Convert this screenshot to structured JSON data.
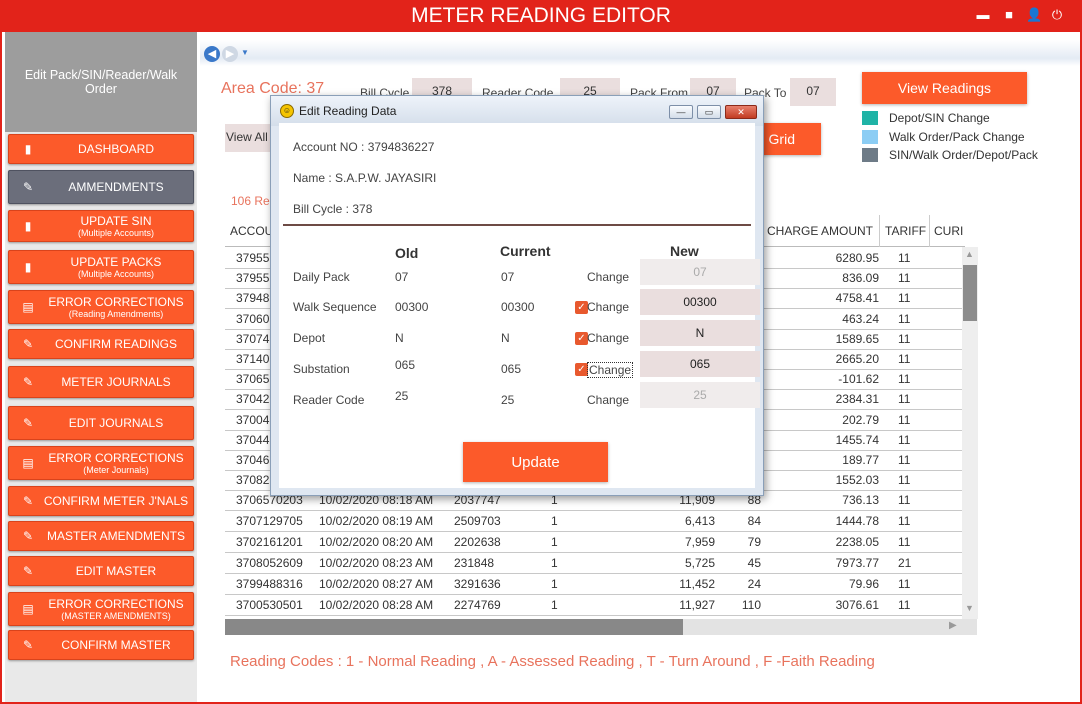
{
  "app": {
    "title": "METER READING EDITOR"
  },
  "window_controls": {
    "minimize": "▬",
    "maximize": "■",
    "user": "👤",
    "power": "⏻"
  },
  "sidebar": {
    "header": "Edit Pack/SIN/Reader/Walk Order",
    "items": [
      {
        "label": "DASHBOARD",
        "sub": "",
        "icon": "document-icon",
        "glyph": "▮"
      },
      {
        "label": "AMMENDMENTS",
        "sub": "",
        "icon": "user-edit-icon",
        "glyph": "✎"
      },
      {
        "label": "UPDATE SIN",
        "sub": "(Multiple Accounts)",
        "icon": "document-icon",
        "glyph": "▮"
      },
      {
        "label": "UPDATE PACKS",
        "sub": "(Multiple Accounts)",
        "icon": "document-icon",
        "glyph": "▮"
      },
      {
        "label": "ERROR CORRECTIONS",
        "sub": "(Reading Amendments)",
        "icon": "list-icon",
        "glyph": "▤"
      },
      {
        "label": "CONFIRM READINGS",
        "sub": "",
        "icon": "pencil-icon",
        "glyph": "✎"
      },
      {
        "label": "METER JOURNALS",
        "sub": "",
        "icon": "user-edit-icon",
        "glyph": "✎"
      },
      {
        "label": "EDIT JOURNALS",
        "sub": "",
        "icon": "user-edit-icon",
        "glyph": "✎"
      },
      {
        "label": "ERROR CORRECTIONS",
        "sub": "(Meter Journals)",
        "icon": "list-icon",
        "glyph": "▤"
      },
      {
        "label": "CONFIRM METER J'NALS",
        "sub": "",
        "icon": "pencil-icon",
        "glyph": "✎"
      },
      {
        "label": "MASTER AMENDMENTS",
        "sub": "",
        "icon": "pencil-icon",
        "glyph": "✎"
      },
      {
        "label": "EDIT MASTER",
        "sub": "",
        "icon": "pencil-icon",
        "glyph": "✎"
      },
      {
        "label": "ERROR CORRECTIONS",
        "sub": "(MASTER AMENDMENTS)",
        "icon": "list-icon",
        "glyph": "▤"
      },
      {
        "label": "CONFIRM MASTER",
        "sub": "",
        "icon": "pencil-icon",
        "glyph": "✎"
      }
    ]
  },
  "filters": {
    "area_code": "Area Code: 37",
    "bill_cycle_label": "Bill Cycle",
    "bill_cycle": "378",
    "reader_code_label": "Reader Code",
    "reader_code": "25",
    "pack_from_label": "Pack From",
    "pack_from": "07",
    "pack_to_label": "Pack To",
    "pack_to": "07"
  },
  "buttons": {
    "view_readings": "View Readings",
    "view_all": "View All",
    "grid": "Grid",
    "update": "Update"
  },
  "legend": [
    {
      "label": "Depot/SIN Change",
      "color": "#1fb3a6"
    },
    {
      "label": "Walk Order/Pack Change",
      "color": "#8ccdf4"
    },
    {
      "label": "SIN/Walk Order/Depot/Pack",
      "color": "#6e7b87"
    }
  ],
  "record_count": "106 Re",
  "grid": {
    "headers": {
      "account": "ACCOU",
      "charge": "CHARGE AMOUNT",
      "tariff": "TARIFF",
      "curr": "CURI"
    },
    "hidden_rows": [
      {
        "acc": "37955",
        "amount": "6280.95",
        "tariff": "11"
      },
      {
        "acc": "37955",
        "amount": "836.09",
        "tariff": "11"
      },
      {
        "acc": "37948",
        "amount": "4758.41",
        "tariff": "11"
      },
      {
        "acc": "37060",
        "amount": "463.24",
        "tariff": "11"
      },
      {
        "acc": "37074",
        "amount": "1589.65",
        "tariff": "11"
      },
      {
        "acc": "37140",
        "amount": "2665.20",
        "tariff": "11"
      },
      {
        "acc": "37065",
        "amount": "-101.62",
        "tariff": "11"
      },
      {
        "acc": "37042",
        "amount": "2384.31",
        "tariff": "11"
      },
      {
        "acc": "37004",
        "amount": "202.79",
        "tariff": "11"
      },
      {
        "acc": "37044",
        "amount": "1455.74",
        "tariff": "11"
      },
      {
        "acc": "37046",
        "amount": "189.77",
        "tariff": "11"
      },
      {
        "acc": "37082",
        "amount": "1552.03",
        "tariff": "11"
      }
    ],
    "rows": [
      {
        "acc": "3706570203",
        "date": "10/02/2020 08:18 AM",
        "num": "2037747",
        "code": "1",
        "reading": "11,909",
        "units": "88",
        "amount": "736.13",
        "tariff": "11"
      },
      {
        "acc": "3707129705",
        "date": "10/02/2020 08:19 AM",
        "num": "2509703",
        "code": "1",
        "reading": "6,413",
        "units": "84",
        "amount": "1444.78",
        "tariff": "11"
      },
      {
        "acc": "3702161201",
        "date": "10/02/2020 08:20 AM",
        "num": "2202638",
        "code": "1",
        "reading": "7,959",
        "units": "79",
        "amount": "2238.05",
        "tariff": "11"
      },
      {
        "acc": "3708052609",
        "date": "10/02/2020 08:23 AM",
        "num": "231848",
        "code": "1",
        "reading": "5,725",
        "units": "45",
        "amount": "7973.77",
        "tariff": "21"
      },
      {
        "acc": "3799488316",
        "date": "10/02/2020 08:27 AM",
        "num": "3291636",
        "code": "1",
        "reading": "11,452",
        "units": "24",
        "amount": "79.96",
        "tariff": "11"
      },
      {
        "acc": "3700530501",
        "date": "10/02/2020 08:28 AM",
        "num": "2274769",
        "code": "1",
        "reading": "11,927",
        "units": "110",
        "amount": "3076.61",
        "tariff": "11"
      }
    ]
  },
  "reading_codes": "Reading Codes : 1 - Normal Reading , A - Assessed Reading , T - Turn Around , F -Faith Reading",
  "dialog": {
    "title": "Edit Reading Data",
    "controls": {
      "min": "—",
      "max": "▭",
      "close": "✕"
    },
    "account": "Account NO : 3794836227",
    "name": "Name : S.A.P.W. JAYASIRI",
    "bill_cycle": "Bill Cycle : 378",
    "col_old": "Old",
    "col_current": "Current",
    "col_new": "New",
    "change_label": "Change",
    "fields": [
      {
        "label": "Daily Pack",
        "old": "07",
        "current": "07",
        "checked": false,
        "new": "07"
      },
      {
        "label": "Walk Sequence",
        "old": "00300",
        "current": "00300",
        "checked": true,
        "new": "00300"
      },
      {
        "label": "Depot",
        "old": "N",
        "current": "N",
        "checked": true,
        "new": "N"
      },
      {
        "label": "Substation",
        "old": "065",
        "current": "065",
        "checked": true,
        "new": "065"
      },
      {
        "label": "Reader Code",
        "old": "25",
        "current": "25",
        "checked": false,
        "new": "25"
      }
    ]
  }
}
